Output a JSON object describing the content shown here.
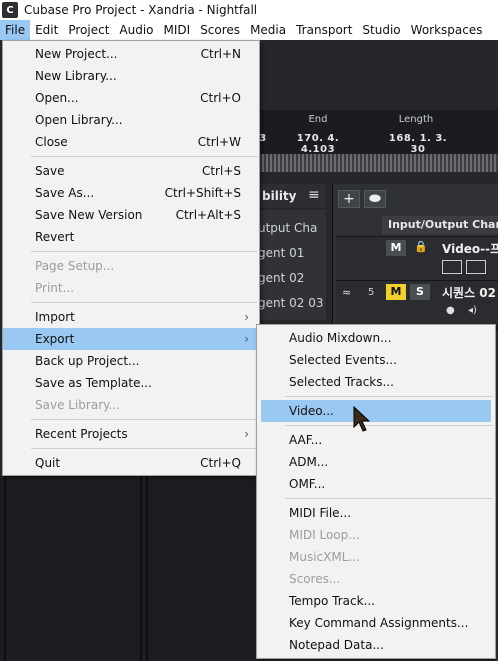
{
  "window": {
    "title": "Cubase Pro Project - Xandria - Nightfall",
    "icon": "cubase-app-icon"
  },
  "menubar": [
    {
      "label": "File",
      "active": true
    },
    {
      "label": "Edit"
    },
    {
      "label": "Project"
    },
    {
      "label": "Audio"
    },
    {
      "label": "MIDI"
    },
    {
      "label": "Scores"
    },
    {
      "label": "Media"
    },
    {
      "label": "Transport"
    },
    {
      "label": "Studio"
    },
    {
      "label": "Workspaces"
    }
  ],
  "transport": {
    "partial_value": "3",
    "end_label": "End",
    "end_value": "170. 4. 4.103",
    "length_label": "Length",
    "length_value": "168. 1. 3. 30"
  },
  "visibility": {
    "tab_label": "bility",
    "rows": [
      "utput Cha",
      "gent 01",
      "gent 02",
      "gent 02 03"
    ]
  },
  "mixer": {
    "io_channel_label": "Input/Output Channe",
    "track1_name": "Video--프",
    "track2_name": "시퀀스 02",
    "track2_number": "5",
    "m_label": "M",
    "s_label": "S"
  },
  "file_menu": {
    "items": [
      {
        "label": "New Project...",
        "shortcut": "Ctrl+N"
      },
      {
        "label": "New Library...",
        "shortcut": ""
      },
      {
        "label": "Open...",
        "shortcut": "Ctrl+O"
      },
      {
        "label": "Open Library...",
        "shortcut": ""
      },
      {
        "label": "Close",
        "shortcut": "Ctrl+W"
      },
      {
        "label": "Save",
        "shortcut": "Ctrl+S"
      },
      {
        "label": "Save As...",
        "shortcut": "Ctrl+Shift+S"
      },
      {
        "label": "Save New Version",
        "shortcut": "Ctrl+Alt+S"
      },
      {
        "label": "Revert",
        "shortcut": ""
      },
      {
        "label": "Page Setup...",
        "shortcut": "",
        "disabled": true
      },
      {
        "label": "Print...",
        "shortcut": "",
        "disabled": true
      },
      {
        "label": "Import",
        "submenu": true
      },
      {
        "label": "Export",
        "submenu": true,
        "highlighted": true
      },
      {
        "label": "Back up Project...",
        "shortcut": ""
      },
      {
        "label": "Save as Template...",
        "shortcut": ""
      },
      {
        "label": "Save Library...",
        "shortcut": "",
        "disabled": true
      },
      {
        "label": "Recent Projects",
        "submenu": true
      },
      {
        "label": "Quit",
        "shortcut": "Ctrl+Q"
      }
    ]
  },
  "export_menu": {
    "items": [
      {
        "label": "Audio Mixdown..."
      },
      {
        "label": "Selected Events..."
      },
      {
        "label": "Selected Tracks..."
      },
      {
        "label": "Video...",
        "highlighted": true
      },
      {
        "label": "AAF..."
      },
      {
        "label": "ADM..."
      },
      {
        "label": "OMF..."
      },
      {
        "label": "MIDI File..."
      },
      {
        "label": "MIDI Loop...",
        "disabled": true
      },
      {
        "label": "MusicXML...",
        "disabled": true
      },
      {
        "label": "Scores...",
        "disabled": true
      },
      {
        "label": "Tempo Track..."
      },
      {
        "label": "Key Command Assignments..."
      },
      {
        "label": "Notepad Data..."
      }
    ]
  },
  "colors": {
    "highlight": "#99c8f3",
    "menu_bg": "#f2f2f2",
    "app_bg": "#25272b",
    "mute_active": "#f2d12e"
  }
}
